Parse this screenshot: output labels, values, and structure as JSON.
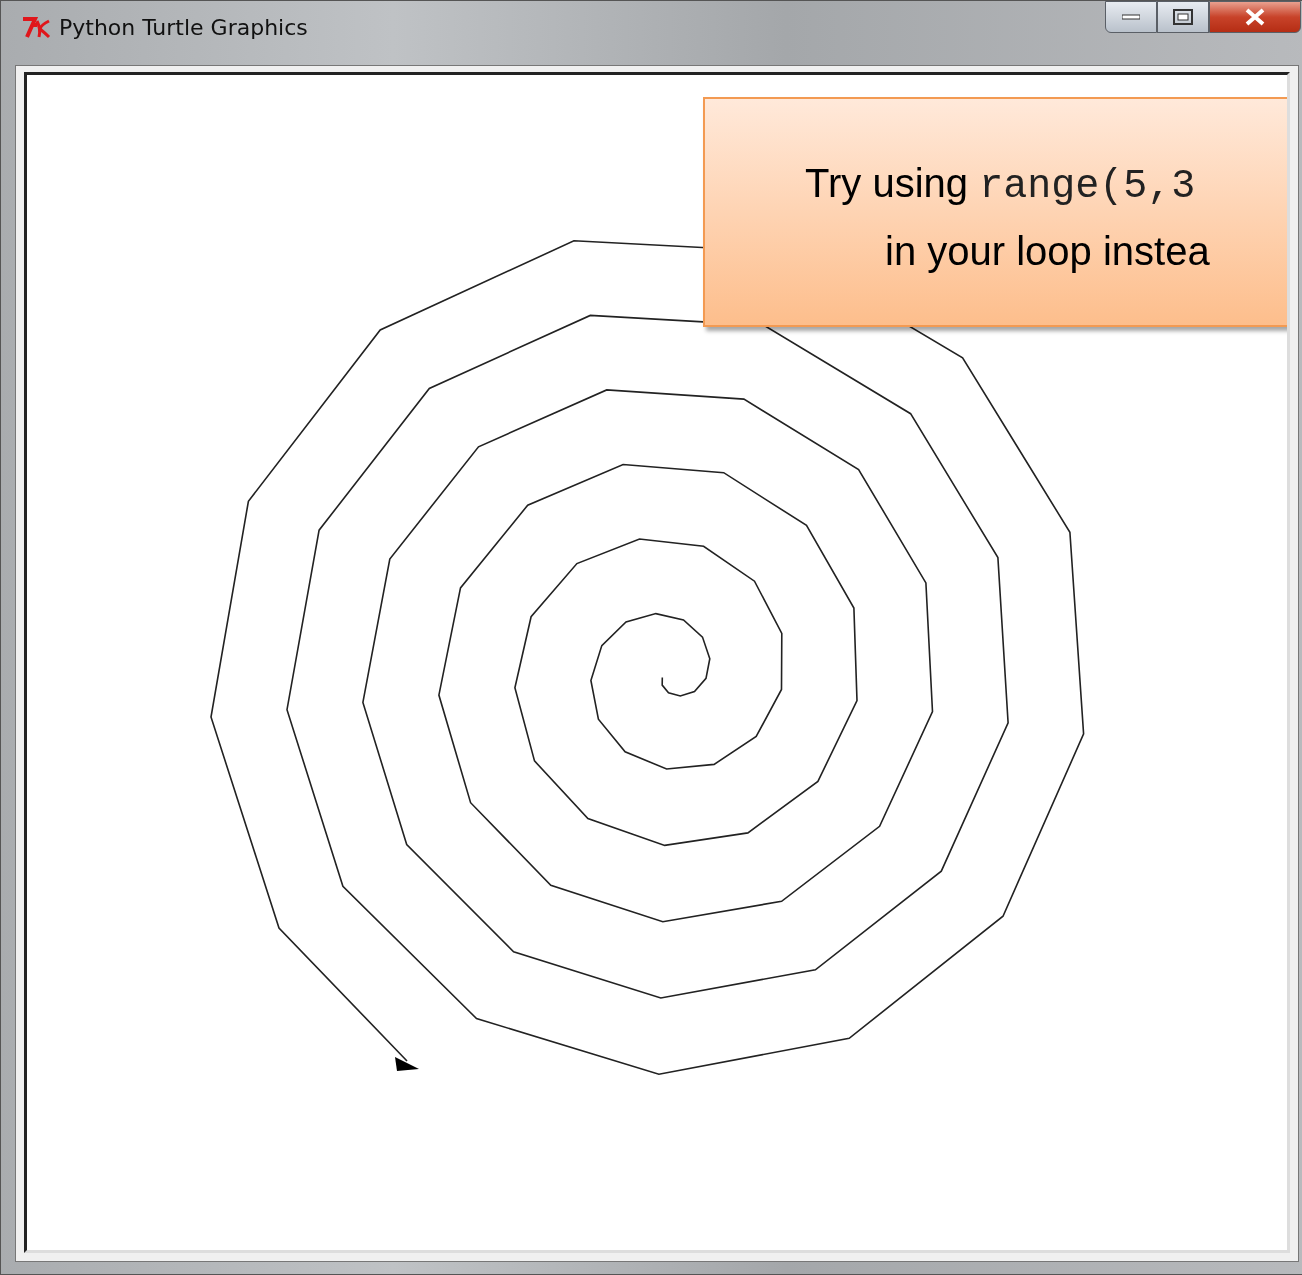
{
  "window": {
    "title": "Python Turtle Graphics"
  },
  "callout": {
    "line_1_text": "Try using",
    "line_1_code": "range(5,3",
    "line_2": "in your loop instea"
  }
}
